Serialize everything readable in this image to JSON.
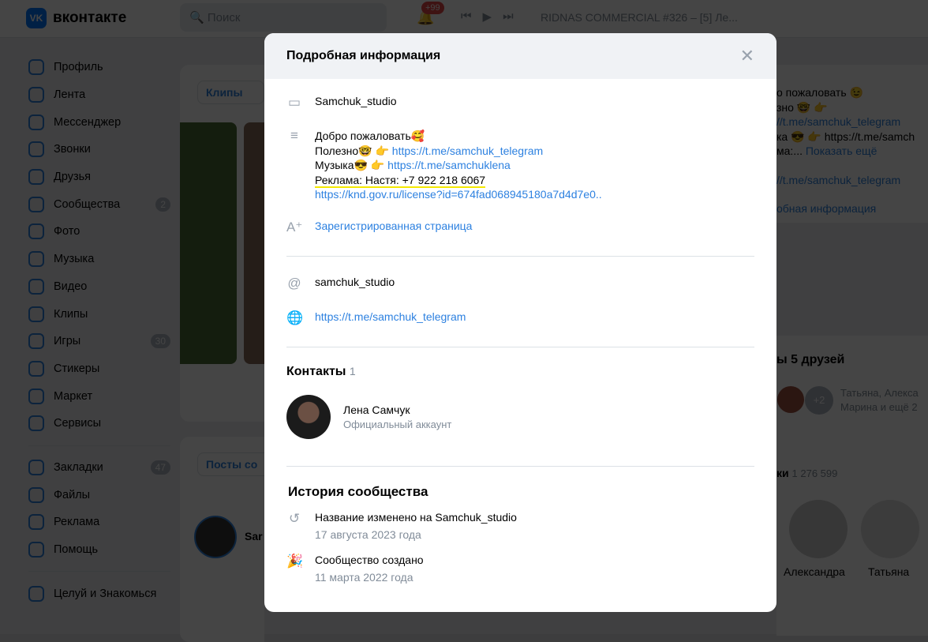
{
  "header": {
    "logo": "вконтакте",
    "logo_mark": "VK",
    "search_placeholder": "Поиск",
    "notif_count": "+99",
    "track": "RIDNAS COMMERCIAL #326 – [5] Ле..."
  },
  "sidebar": [
    {
      "label": "Профиль"
    },
    {
      "label": "Лента"
    },
    {
      "label": "Мессенджер"
    },
    {
      "label": "Звонки"
    },
    {
      "label": "Друзья"
    },
    {
      "label": "Сообщества",
      "count": "2"
    },
    {
      "label": "Фото"
    },
    {
      "label": "Музыка"
    },
    {
      "label": "Видео"
    },
    {
      "label": "Клипы"
    },
    {
      "label": "Игры",
      "count": "30"
    },
    {
      "label": "Стикеры"
    },
    {
      "label": "Маркет"
    },
    {
      "label": "Сервисы"
    }
  ],
  "sidebar2": [
    {
      "label": "Закладки",
      "count": "47"
    },
    {
      "label": "Файлы"
    },
    {
      "label": "Реклама"
    },
    {
      "label": "Помощь"
    }
  ],
  "sidebar3": [
    {
      "label": "Целуй и Знакомься"
    }
  ],
  "bg": {
    "clips_tab": "Клипы",
    "posts_tab": "Посты со",
    "post_author": "Sar",
    "desc_lines": [
      "о пожаловать 😉",
      "зно 🤓 👉",
      "//t.me/samchuk_telegram",
      "ка 😎 👉 https://t.me/samch",
      "ма:... "
    ],
    "show_more": "Показать ещё",
    "tg": "//t.me/samchuk_telegram",
    "more_info": "обная информация",
    "friends_title": "ы 5 друзей",
    "friends_plus": "+2",
    "friends_names": "Татьяна, Алекса Марина и ещё 2",
    "members_title": "ки",
    "members_count": "1 276 599",
    "members": [
      "Александра",
      "Татьяна"
    ]
  },
  "modal": {
    "title": "Подробная информация",
    "screen_name": "Samchuk_studio",
    "desc": {
      "l1": "Добро пожаловать🥰",
      "l2": "Полезно🤓 👉 ",
      "l2_link": "https://t.me/samchuk_telegram",
      "l3": "Музыка😎 👉 ",
      "l3_link": "https://t.me/samchuklena",
      "l4": "Реклама: Настя: +7 922 218 6067",
      "l5_link": "https://knd.gov.ru/license?id=674fad068945180a7d4d7e0.."
    },
    "registered": "Зарегистрированная страница",
    "email": "samchuk_studio",
    "site": "https://t.me/samchuk_telegram",
    "contacts_title": "Контакты",
    "contacts_count": "1",
    "contact": {
      "name": "Лена Самчук",
      "role": "Официальный аккаунт"
    },
    "history_title": "История сообщества",
    "history": [
      {
        "text": "Название изменено на Samchuk_studio",
        "date": "17 августа 2023 года"
      },
      {
        "text": "Сообщество создано",
        "date": "11 марта 2022 года"
      }
    ]
  }
}
